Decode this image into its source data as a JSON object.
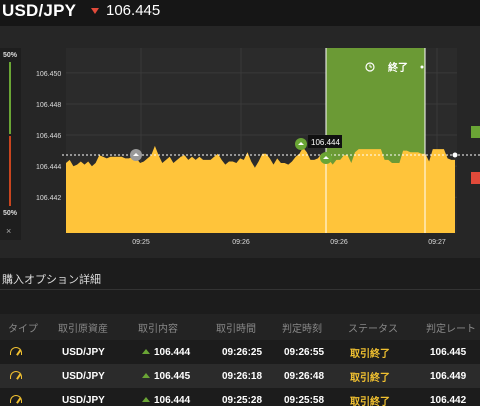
{
  "header": {
    "pair": "USD/JPY",
    "rate": "106.445"
  },
  "ratio": {
    "high": "50%",
    "low": "50%",
    "close": "×"
  },
  "chart": {
    "y_ticks": [
      "106.450",
      "106.448",
      "106.446",
      "106.444",
      "106.442"
    ],
    "x_ticks": [
      "09:25",
      "09:26",
      "09:26",
      "09:27"
    ],
    "end_label": "終了",
    "marker_label": "106.444"
  },
  "chart_data": {
    "type": "area",
    "ylim": [
      106.4397,
      106.4516
    ],
    "y_ticks": [
      106.45,
      106.448,
      106.446,
      106.444,
      106.442
    ],
    "x_ticks": [
      "09:25",
      "09:26",
      "09:26",
      "09:27"
    ],
    "reference_line": 106.445,
    "series": [
      {
        "values": [
          106.4442,
          106.4444,
          106.444,
          106.4441,
          106.4443,
          106.4441,
          106.4443,
          106.444,
          106.4442,
          106.4447,
          106.4446,
          106.4445,
          106.4446,
          106.4446,
          106.4446,
          106.4446,
          106.4445,
          106.4445,
          106.4446,
          106.4445,
          106.4442,
          106.4443,
          106.4445,
          106.4447,
          106.4453,
          106.4447,
          106.4442,
          106.4444,
          106.4446,
          106.4442,
          106.4444,
          106.4446,
          106.4447,
          106.4444,
          106.4446,
          106.4444,
          106.4446,
          106.4444,
          106.4444,
          106.4444,
          106.4446,
          106.4448,
          106.4444,
          106.4441,
          106.4443,
          106.4443,
          106.4442,
          106.4445,
          106.4444,
          106.4449,
          106.4443,
          106.4439,
          106.4443,
          106.4448,
          106.4448,
          106.4445,
          106.4441,
          106.4445,
          106.4442,
          106.4442,
          106.4441,
          106.4443,
          106.4446,
          106.4448,
          106.4452,
          106.4449,
          106.4444,
          106.4444,
          106.4445,
          106.4448,
          106.4448,
          106.4444,
          106.4441,
          106.4444,
          106.4444,
          106.4447,
          106.4447,
          106.4442,
          106.4449,
          106.4451,
          106.4451,
          106.4451,
          106.4451,
          106.4451,
          106.4451,
          106.4451,
          106.4444,
          106.4444,
          106.4442,
          106.4442,
          106.4442,
          106.445,
          106.445,
          106.4449,
          106.4449,
          106.4449,
          106.4448,
          106.4448,
          106.4443,
          106.4451,
          106.4451,
          106.4451,
          106.4451,
          106.4445,
          106.4444,
          106.4444
        ]
      }
    ],
    "annotations": [
      "106.444",
      "終了"
    ]
  },
  "section": {
    "title": "購入オプション詳細"
  },
  "table": {
    "headers": [
      "タイプ",
      "取引原資産",
      "取引内容",
      "取引時間",
      "判定時刻",
      "ステータス",
      "判定レート"
    ],
    "rows": [
      {
        "asset": "USD/JPY",
        "content": "106.444",
        "trade_time": "09:26:25",
        "judge_time": "09:26:55",
        "status": "取引終了",
        "rate": "106.445"
      },
      {
        "asset": "USD/JPY",
        "content": "106.445",
        "trade_time": "09:26:18",
        "judge_time": "09:26:48",
        "status": "取引終了",
        "rate": "106.449"
      },
      {
        "asset": "USD/JPY",
        "content": "106.444",
        "trade_time": "09:25:28",
        "judge_time": "09:25:58",
        "status": "取引終了",
        "rate": "106.442"
      }
    ]
  },
  "colors": {
    "area": "#ffc43a",
    "highlight": "#6b9a35",
    "up": "#6aa535",
    "down": "#e14a3a"
  }
}
